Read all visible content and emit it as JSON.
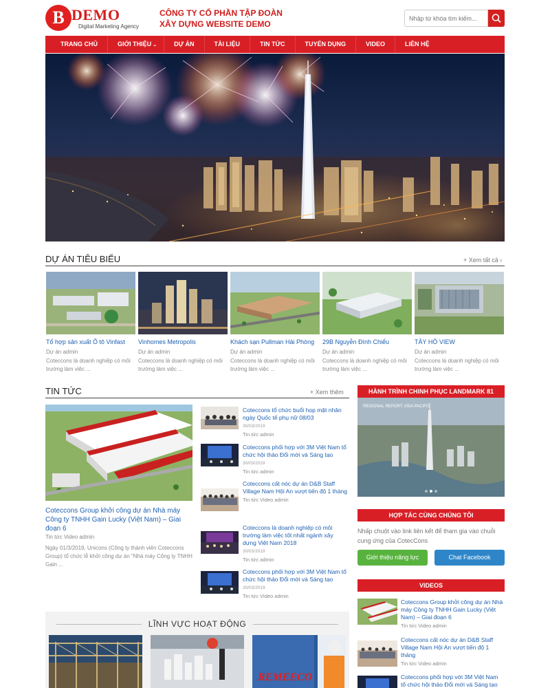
{
  "brand": {
    "logo_letter": "B",
    "logo_word": "DEMO",
    "logo_subtitle": "Digital Marketing Agency",
    "company_line1": "CÔNG TY CỔ PHẦN TẬP ĐOÀN",
    "company_line2": "XÂY DỰNG WEBSITE DEMO",
    "accent_color": "#d91f26"
  },
  "search": {
    "placeholder": "Nhập từ khóa tìm kiếm...",
    "icon": "search-icon"
  },
  "nav": {
    "items": [
      {
        "label": "TRANG CHỦ"
      },
      {
        "label": "GIỚI THIỆU",
        "has_dropdown": true
      },
      {
        "label": "DỰ ÁN"
      },
      {
        "label": "TÀI LIỆU"
      },
      {
        "label": "TIN TỨC"
      },
      {
        "label": "TUYỂN DỤNG"
      },
      {
        "label": "VIDEO"
      },
      {
        "label": "LIÊN HỆ"
      }
    ]
  },
  "projects": {
    "title": "DỰ ÁN TIÊU BIỂU",
    "see_all": "+ Xem tất cả",
    "items": [
      {
        "title": "Tổ hợp sản xuất Ô tô Vinfast",
        "meta": "Dự án admin",
        "desc": "Coteccons là doanh nghiệp có môi trường làm việc ..."
      },
      {
        "title": "Vinhomes Metropolis",
        "meta": "Dự án admin",
        "desc": "Coteccons là doanh nghiệp có môi trường làm việc ..."
      },
      {
        "title": "Khách sạn Pullman Hải Phòng",
        "meta": "Dự án admin",
        "desc": "Coteccons là doanh nghiệp có môi trường làm việc ..."
      },
      {
        "title": "29B Nguyễn Đình Chiểu",
        "meta": "Dự án admin",
        "desc": "Coteccons là doanh nghiệp có môi trường làm việc ..."
      },
      {
        "title": "TÂY HỒ VIEW",
        "meta": "Dự án admin",
        "desc": "Coteccons là doanh nghiệp có môi trường làm việc ..."
      }
    ]
  },
  "news": {
    "title": "TIN TỨC",
    "see_more": "+ Xem thêm",
    "featured": {
      "title": "Coteccons Group khởi công dự án Nhà máy Công ty TNHH Gain Lucky (Việt Nam) – Giai đoạn 6",
      "meta": "Tin tức Video admin",
      "desc": "Ngày 01/3/2019, Unicons (Công ty thành viên Coteccons Group) tổ chức lễ khởi công dự án \"Nhà máy Công ty TNHH Gain ..."
    },
    "items": [
      {
        "title": "Coteccons tổ chức buổi họp mặt nhân ngày Quốc tế phụ nữ 08/03",
        "date": "30/03/2019",
        "meta": "Tin tức admin"
      },
      {
        "title": "Coteccons phối hợp với 3M Việt Nam tổ chức hội thảo Đổi mới và Sáng tạo",
        "date": "30/03/2019",
        "meta": "Tin tức admin"
      },
      {
        "title": "Coteccons cất nóc dự án D&B Staff Village Nam Hội An vượt tiến độ 1 tháng",
        "date": "30/03/2019",
        "meta": "Tin tức Video admin"
      },
      {
        "title": "Coteccons là doanh nghiệp có môi trường làm việc tốt nhất ngành xây dựng Việt Nam 2018",
        "date": "30/03/2019",
        "meta": "Tin tức admin"
      },
      {
        "title": "Coteccons phối hợp với 3M Việt Nam tổ chức hội thảo Đổi mới và Sáng tạo",
        "date": "30/03/2019",
        "meta": "Tin tức Video admin"
      }
    ]
  },
  "sidebar": {
    "landmark_title": "HÀNH TRÌNH CHINH PHỤC LANDMARK 81",
    "landmark_caption": "REGIONAL REPORT: ASIA PACIFIC",
    "partner_title": "HỢP TÁC CÙNG CHÚNG TÔI",
    "partner_text": "Nhấp chuột vào link liên kết để tham gia vào chuỗi cung ứng của CotecCons",
    "partner_btn_green": "Giới thiệu năng lực",
    "partner_btn_blue": "Chat Facebook",
    "videos_title": "VIDEOS",
    "videos": [
      {
        "title": "Coteccons Group khởi công dự án Nhà máy Công ty TNHH Gain Lucky (Việt Nam) – Giai đoạn 6",
        "meta": "Tin tức Video admin"
      },
      {
        "title": "Coteccons cất nóc dự án D&B Staff Village Nam Hội An vượt tiến độ 1 tháng",
        "meta": "Tin tức Video admin"
      },
      {
        "title": "Coteccons phối hợp với 3M Việt Nam tổ chức hội thảo Đổi mới và Sáng tạo",
        "meta": ""
      }
    ]
  },
  "fields": {
    "title": "LĨNH VỰC HOẠT ĐỘNG",
    "remeeco_logo": "REMEECO"
  }
}
